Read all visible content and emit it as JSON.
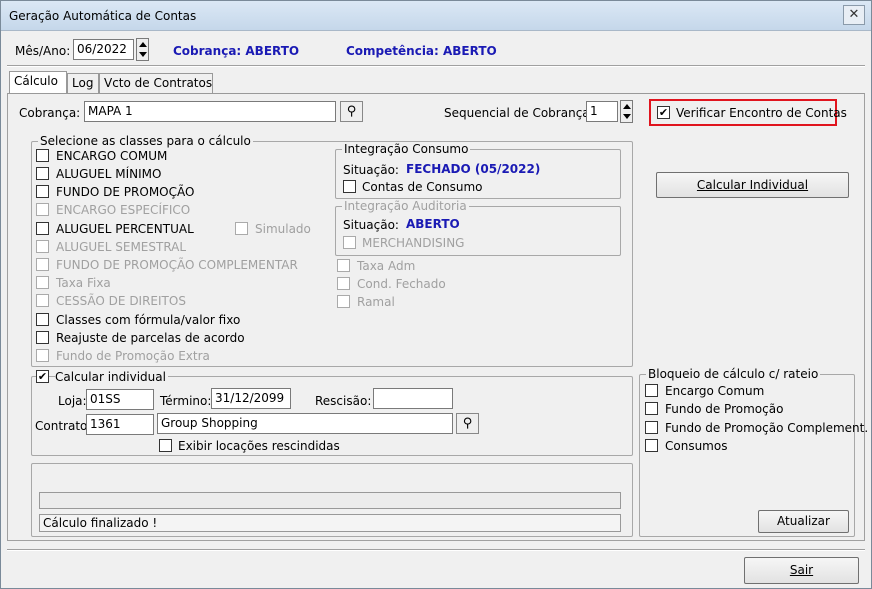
{
  "window": {
    "title": "Geração Automática de Contas",
    "close_glyph": "✕"
  },
  "header": {
    "mes_ano_label": "Mês/Ano:",
    "mes_ano_value": "06/2022",
    "cobranca_status": "Cobrança: ABERTO",
    "competencia_status": "Competência: ABERTO"
  },
  "tabs": [
    {
      "label": "Cálculo"
    },
    {
      "label": "Log"
    },
    {
      "label": "Vcto de Contratos"
    }
  ],
  "cobranca": {
    "label": "Cobrança:",
    "value": "MAPA 1",
    "sequencial_label": "Sequencial de Cobrança:",
    "sequencial_value": "1",
    "verificar_label": "Verificar Encontro de Contas",
    "verificar_checked": true
  },
  "classes": {
    "title": "Selecione as classes para o cálculo",
    "items": [
      {
        "label": "ENCARGO COMUM",
        "enabled": true
      },
      {
        "label": "ALUGUEL MÍNIMO",
        "enabled": true
      },
      {
        "label": "FUNDO DE PROMOÇÃO",
        "enabled": true
      },
      {
        "label": "ENCARGO ESPECÍFICO",
        "enabled": false
      },
      {
        "label": "ALUGUEL PERCENTUAL",
        "enabled": true
      },
      {
        "label": "ALUGUEL SEMESTRAL",
        "enabled": false
      },
      {
        "label": "FUNDO DE PROMOÇÃO COMPLEMENTAR",
        "enabled": false
      },
      {
        "label": "Taxa Fixa",
        "enabled": false
      },
      {
        "label": "CESSÃO DE DIREITOS",
        "enabled": false
      },
      {
        "label": "Classes com fórmula/valor fixo",
        "enabled": true
      },
      {
        "label": "Reajuste de parcelas de acordo",
        "enabled": true
      },
      {
        "label": "Fundo de Promoção Extra",
        "enabled": false
      }
    ],
    "simulado_label": "Simulado",
    "extra_items": [
      {
        "label": "Taxa Adm"
      },
      {
        "label": "Cond. Fechado"
      },
      {
        "label": "Ramal"
      }
    ]
  },
  "integracao_consumo": {
    "title": "Integração Consumo",
    "situacao_label": "Situação:",
    "situacao_value": "FECHADO (05/2022)",
    "check_label": "Contas de Consumo"
  },
  "integracao_auditoria": {
    "title": "Integração Auditoria",
    "situacao_label": "Situação:",
    "situacao_value": "ABERTO",
    "check_label": "MERCHANDISING"
  },
  "calcular_individual_button": "Calcular Individual",
  "individual": {
    "title": "Calcular individual",
    "checked": true,
    "loja_label": "Loja:",
    "loja_value": "01SS",
    "termino_label": "Término:",
    "termino_value": "31/12/2099",
    "rescisao_label": "Rescisão:",
    "rescisao_value": "",
    "contrato_label": "Contrato:",
    "contrato_value": "1361",
    "contrato_name": "Group Shopping",
    "exibir_label": "Exibir locações rescindidas"
  },
  "status": {
    "message": "Cálculo finalizado !",
    "progress": 0
  },
  "bloqueio": {
    "title": "Bloqueio de cálculo c/ rateio",
    "items": [
      {
        "label": "Encargo Comum"
      },
      {
        "label": "Fundo de Promoção"
      },
      {
        "label": "Fundo de Promoção Complement."
      },
      {
        "label": "Consumos"
      }
    ],
    "atualizar_button": "Atualizar"
  },
  "sair_button": "Sair",
  "colors": {
    "accent_blue": "#1a1ab4",
    "highlight_red": "#e0141e",
    "disabled_text": "#a0a0a0"
  },
  "icons": {
    "binoculars": "binoculars-icon",
    "check": "✔"
  }
}
